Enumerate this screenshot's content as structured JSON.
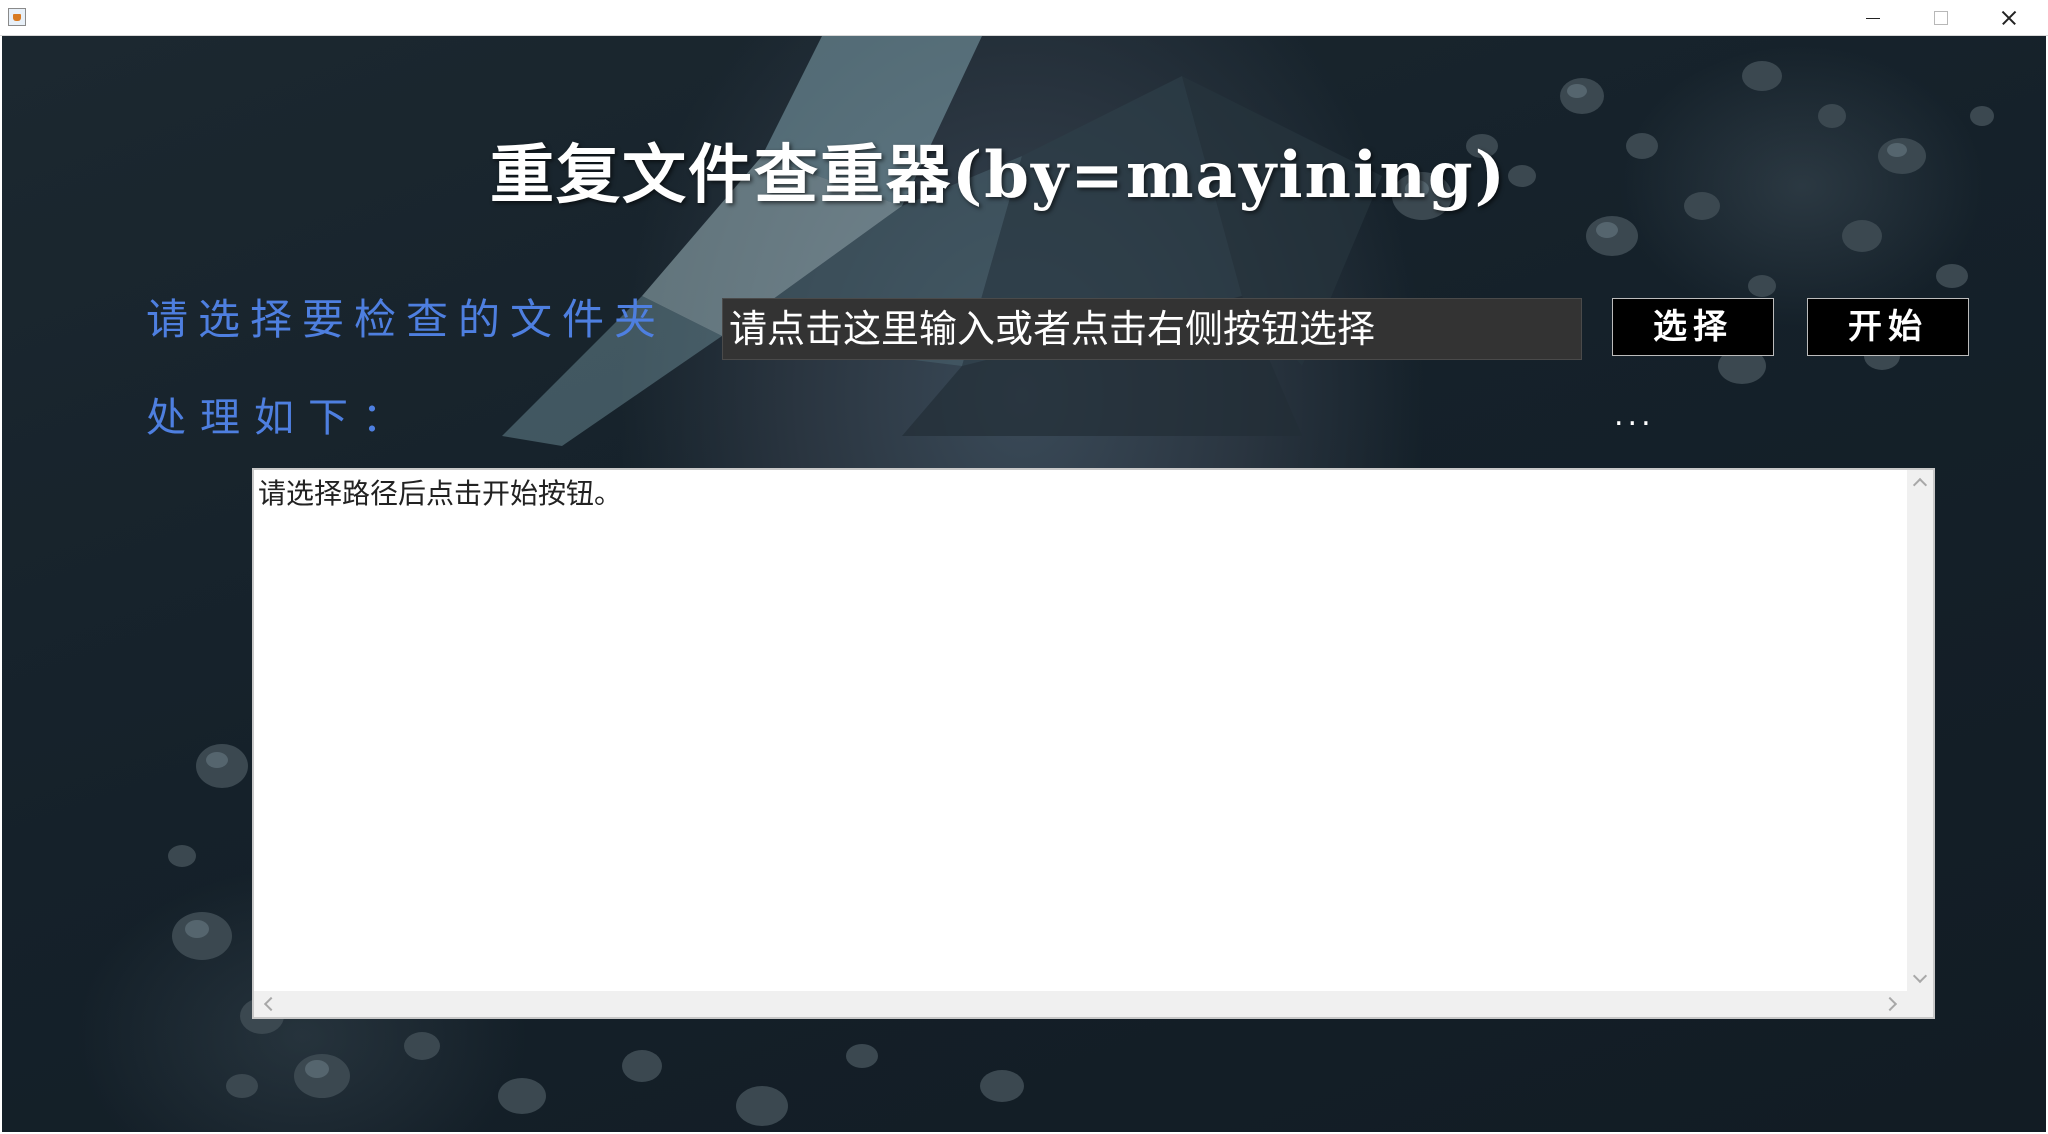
{
  "window": {
    "title_icon": "java-coffee-icon",
    "controls": {
      "minimize": "minimize-icon",
      "maximize": "maximize-icon",
      "close": "close-icon"
    }
  },
  "app": {
    "title": "重复文件查重器(by=mayining)",
    "prompt_label": "请选择要检查的文件夹",
    "path_placeholder": "请点击这里输入或者点击右侧按钮选择",
    "select_button": "选择",
    "start_button": "开始",
    "process_label": "处理如下：",
    "status_text": "...",
    "output_text": "请选择路径后点击开始按钮。"
  },
  "colors": {
    "background": "#15212a",
    "title_text": "#ffffff",
    "label_text": "#4e7fe0",
    "input_bg": "#333333",
    "button_bg": "#000000"
  }
}
